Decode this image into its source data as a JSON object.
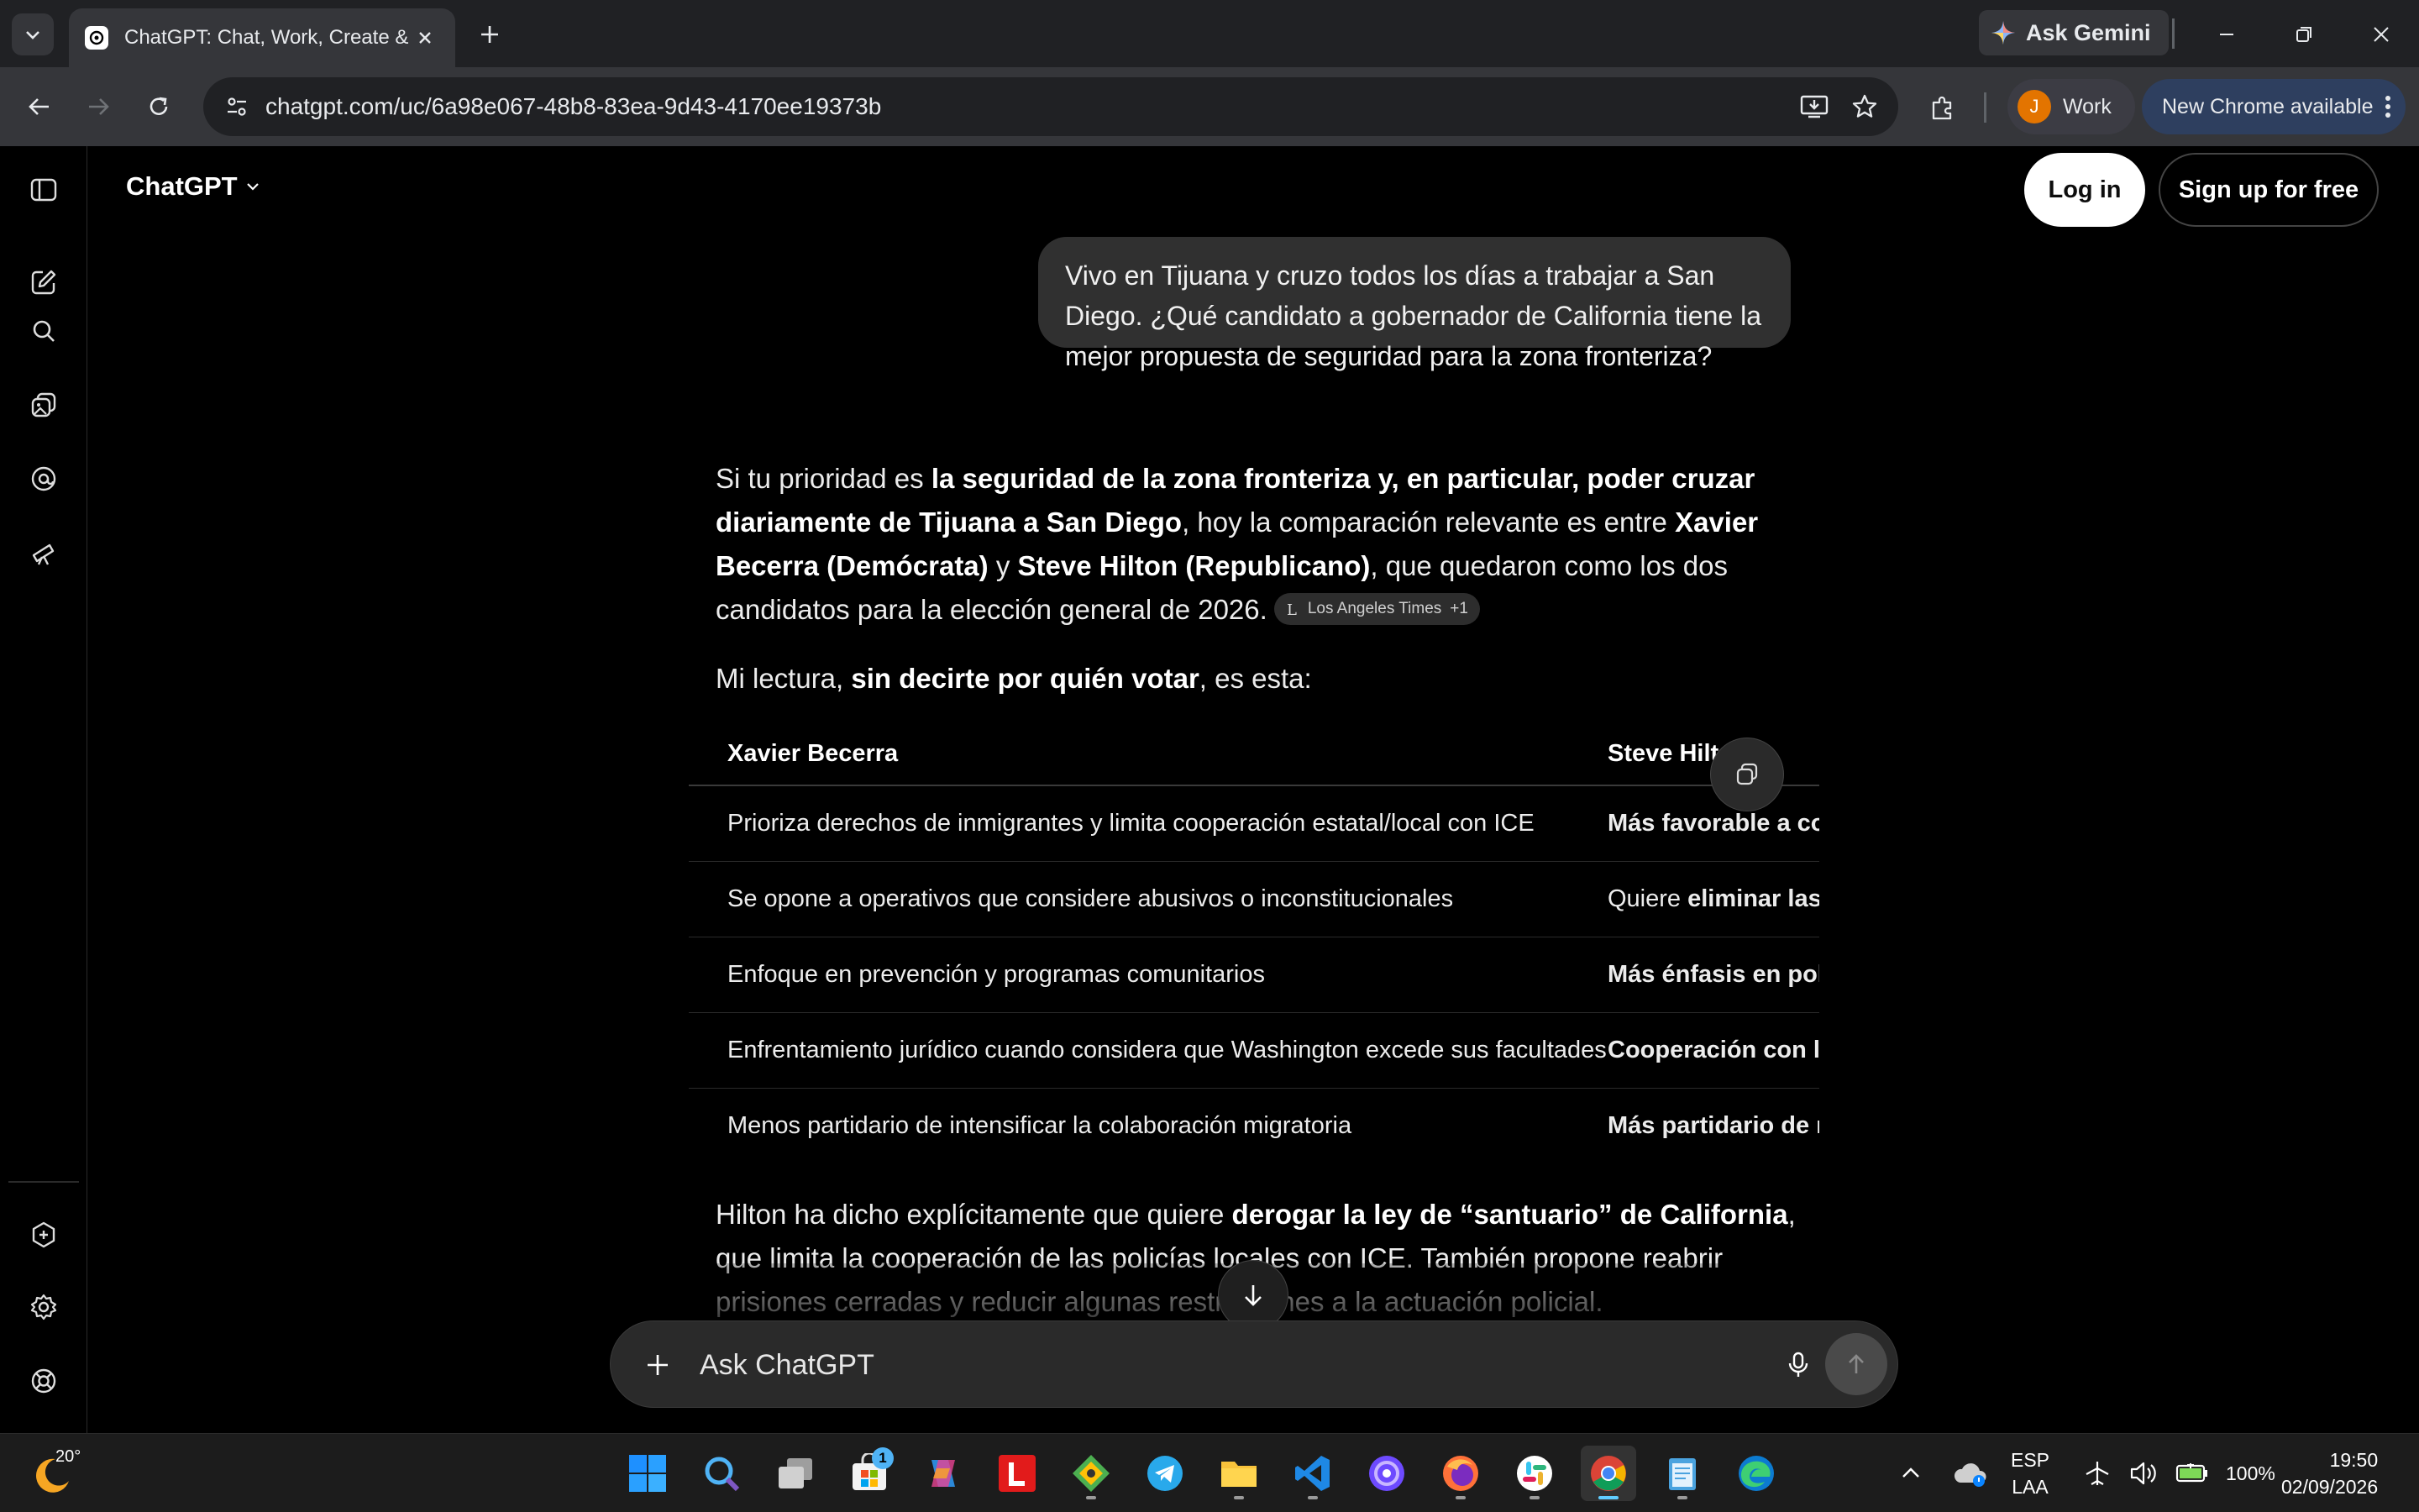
{
  "browser": {
    "tab_title": "ChatGPT: Chat, Work, Create &",
    "gemini_label": "Ask Gemini",
    "url": "chatgpt.com/uc/6a98e067-48b8-83ea-9d43-4170ee19373b",
    "profile_initial": "J",
    "profile_label": "Work",
    "update_label": "New Chrome available"
  },
  "header": {
    "brand": "ChatGPT",
    "login_label": "Log in",
    "signup_label": "Sign up for free"
  },
  "user_message": "Vivo en Tijuana y cruzo todos los días a trabajar a San Diego. ¿Qué candidato a gobernador de California tiene la mejor propuesta de seguridad para la zona fronteriza?",
  "answer": {
    "p1": {
      "t1": "Si tu prioridad es ",
      "b1": "la seguridad de la zona fronteriza y, en particular, poder cruzar diariamente de Tijuana a San Diego",
      "t2": ", hoy la comparación relevante es entre ",
      "b2": "Xavier Becerra (Demócrata)",
      "t3": " y ",
      "b3": "Steve Hilton (Republicano)",
      "t4": ", que quedaron como los dos candidatos para la elección general de 2026.",
      "citation": "Los Angeles Times",
      "citation_extra": "+1"
    },
    "p2": {
      "t1": "Mi lectura, ",
      "b1": "sin decirte por quién votar",
      "t2": ", es esta:"
    },
    "table": {
      "headers": [
        "Xavier Becerra",
        "Steve Hilton"
      ],
      "rows": [
        {
          "becerra": "Prioriza derechos de inmigrantes y limita cooperación estatal/local con ICE",
          "hilton_bold": "Más favorable a coo",
          "hilton_plain": ""
        },
        {
          "becerra": "Se opone a operativos que considere abusivos o inconstitucionales",
          "hilton_plain": "Quiere ",
          "hilton_bold": "eliminar las r"
        },
        {
          "becerra": "Enfoque en prevención y programas comunitarios",
          "hilton_bold": "Más énfasis en polic",
          "hilton_plain": ""
        },
        {
          "becerra": "Enfrentamiento jurídico cuando considera que Washington excede sus facultades",
          "hilton_bold": "Cooperación con la",
          "hilton_plain": ""
        },
        {
          "becerra": "Menos partidario de intensificar la colaboración migratoria",
          "hilton_bold": "Más partidario de re",
          "hilton_plain": ""
        }
      ]
    },
    "p3": {
      "t1": "Hilton ha dicho explícitamente que quiere ",
      "b1": "derogar la ley de “santuario” de California",
      "t2": ", que limita la cooperación de las policías locales con ICE. También propone reabrir prisiones cerradas y reducir algunas restricciones a la actuación policial."
    }
  },
  "composer": {
    "placeholder": "Ask ChatGPT"
  },
  "taskbar": {
    "temperature": "20°",
    "store_badge": "1",
    "lang_top": "ESP",
    "lang_bottom": "LAA",
    "battery": "100%",
    "time": "19:50",
    "date": "02/09/2026"
  }
}
